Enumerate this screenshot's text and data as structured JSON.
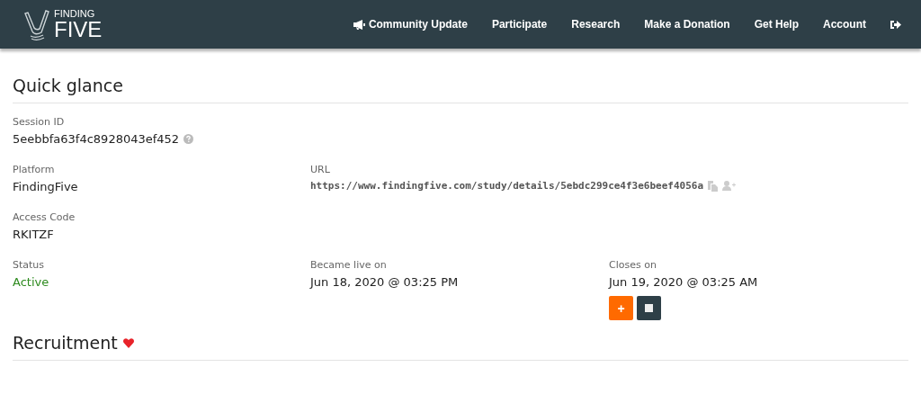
{
  "logo": {
    "top": "FINDING",
    "bottom": "FIVE"
  },
  "nav": [
    {
      "label": "Community Update",
      "kind": "announcement"
    },
    {
      "label": "Participate",
      "kind": "link"
    },
    {
      "label": "Research",
      "kind": "link"
    },
    {
      "label": "Make a Donation",
      "kind": "link"
    },
    {
      "label": "Get Help",
      "kind": "link"
    },
    {
      "label": "Account",
      "kind": "link"
    },
    {
      "kind": "logout"
    }
  ],
  "quick_glance": {
    "title": "Quick glance",
    "session_id": {
      "label": "Session ID",
      "value": "5eebbfa63f4c8928043ef452"
    },
    "platform": {
      "label": "Platform",
      "value": "FindingFive"
    },
    "url": {
      "label": "URL",
      "value": "https://www.findingfive.com/study/details/5ebdc299ce4f3e6beef4056a"
    },
    "access_code": {
      "label": "Access Code",
      "value": "RKITZF"
    },
    "status": {
      "label": "Status",
      "value": "Active",
      "color": "#2e8b1f"
    },
    "became_live": {
      "label": "Became live on",
      "value": "Jun 18, 2020 @ 03:25 PM"
    },
    "closes": {
      "label": "Closes on",
      "value": "Jun 19, 2020 @ 03:25 AM"
    },
    "buttons": [
      {
        "kind": "extend",
        "label": "+"
      },
      {
        "kind": "stop"
      }
    ]
  },
  "recruitment": {
    "title": "Recruitment"
  }
}
